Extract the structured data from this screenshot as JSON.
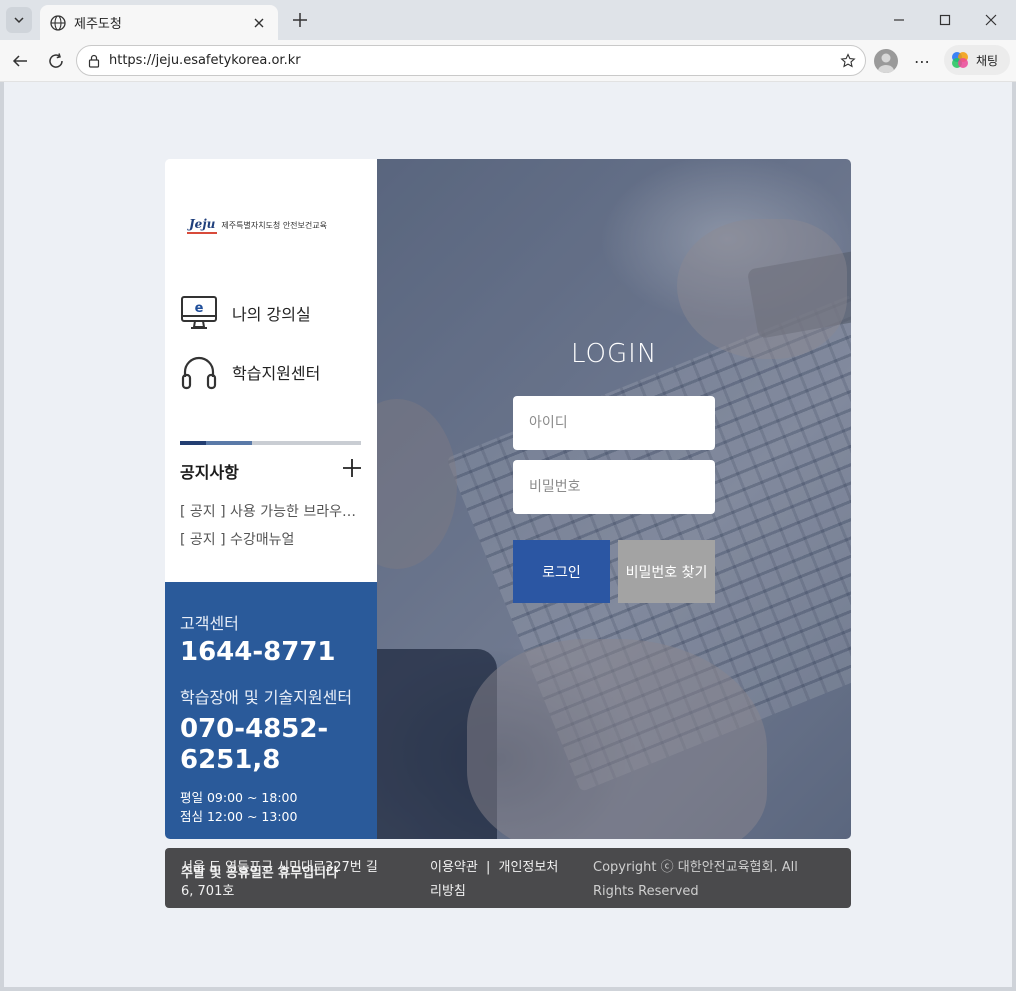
{
  "browser": {
    "tab_title": "제주도청",
    "url": "https://jeju.esafetykorea.or.kr",
    "copilot_label": "채팅"
  },
  "logo": {
    "mark": "Jeju",
    "text": "제주특별자치도청 안전보건교육"
  },
  "menu": {
    "classroom": "나의 강의실",
    "support": "학습지원센터"
  },
  "notice": {
    "title": "공지사항",
    "items": [
      "[ 공지 ] 사용 가능한 브라우저 안내",
      "[ 공지 ] 수강매뉴얼"
    ]
  },
  "customer_center": {
    "label": "고객센터",
    "phone": "1644-8771",
    "tech_label": "학습장애 및 기술지원센터",
    "tech_phone": "070-4852-6251,8",
    "hours_weekday": "평일 09:00 ~ 18:00",
    "hours_lunch": "점심 12:00 ~ 13:00",
    "hours_weekend": "주말 및 공휴일은 휴무입니다"
  },
  "login": {
    "title": "LOGIN",
    "id_placeholder": "아이디",
    "pw_placeholder": "비밀번호",
    "login_button": "로그인",
    "find_pw_button": "비밀번호 찾기"
  },
  "footer": {
    "address": "서울 도 영등포구 시민대로327번 길 6, 701호",
    "terms": "이용약관",
    "separator": "|",
    "privacy": "개인정보처리방침",
    "copyright": "Copyright ⓒ 대한안전교육협회. All Rights Reserved"
  },
  "colors": {
    "brand_blue": "#2b56a3",
    "panel_blue": "#2a5a9a",
    "footer_gray": "#4a4a4c"
  }
}
